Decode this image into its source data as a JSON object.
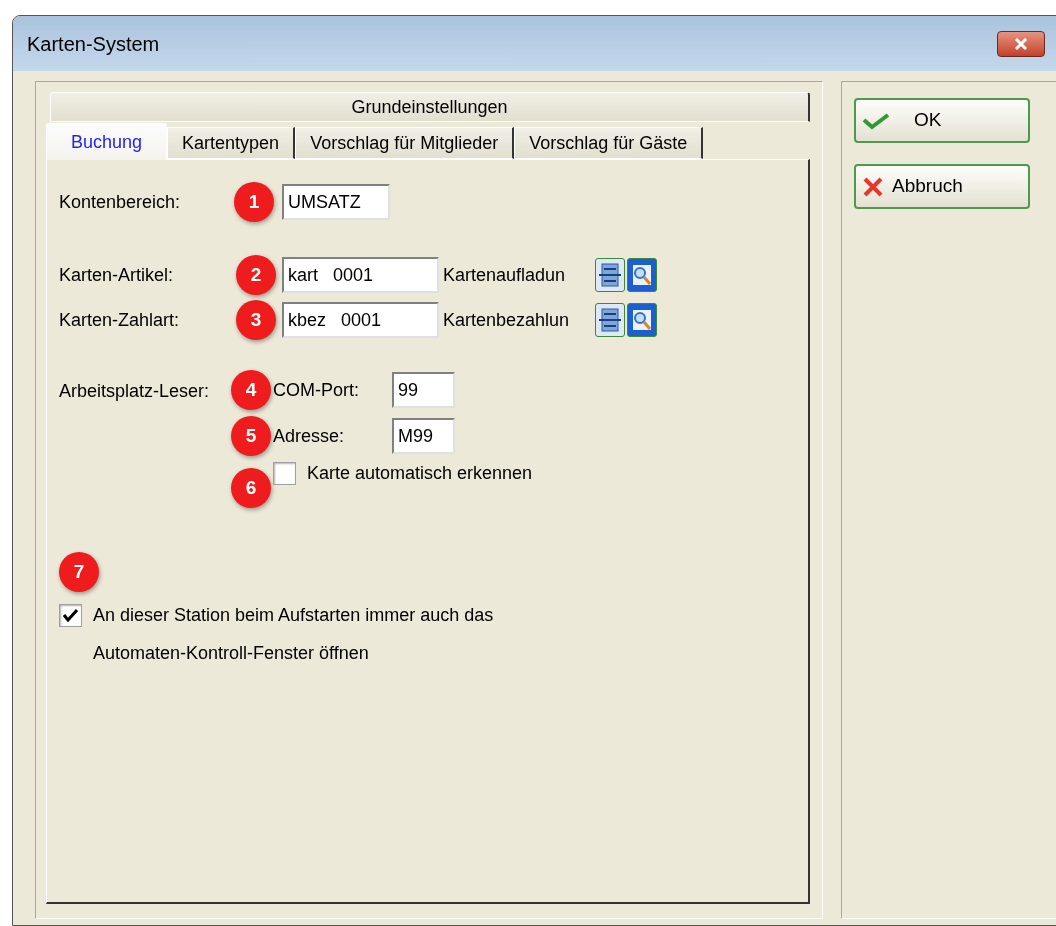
{
  "window": {
    "title": "Karten-System"
  },
  "tabs": {
    "upper": [
      {
        "label": "Grundeinstellungen",
        "selected": false
      }
    ],
    "lower": [
      {
        "label": "Buchung",
        "selected": true
      },
      {
        "label": "Kartentypen",
        "selected": false
      },
      {
        "label": "Vorschlag für Mitglieder",
        "selected": false
      },
      {
        "label": "Vorschlag für Gäste",
        "selected": false
      }
    ]
  },
  "account_range": {
    "label": "Kontenbereich:",
    "marker": "1",
    "value": "UMSATZ"
  },
  "card_rows": [
    {
      "label": "Karten-Artikel:",
      "marker": "2",
      "value": "kart   0001",
      "description": "Kartenaufladun"
    },
    {
      "label": "Karten-Zahlart:",
      "marker": "3",
      "value": "kbez   0001",
      "description": "Kartenbezahlun"
    }
  ],
  "reader": {
    "label": "Arbeitsplatz-Leser:",
    "fields": [
      {
        "marker": "4",
        "label": "COM-Port:",
        "value": "99"
      },
      {
        "marker": "5",
        "label": "Adresse:",
        "value": "M99"
      }
    ],
    "auto_detect": {
      "marker": "6",
      "label": "Karte automatisch erkennen",
      "checked": false
    }
  },
  "station": {
    "marker": "7",
    "label": "An dieser Station beim Aufstarten immer auch das\nAutomaten-Kontroll-Fenster öffnen",
    "checked": true
  },
  "buttons": [
    {
      "kind": "ok",
      "label": "OK"
    },
    {
      "kind": "cancel",
      "label": "Abbruch"
    }
  ]
}
